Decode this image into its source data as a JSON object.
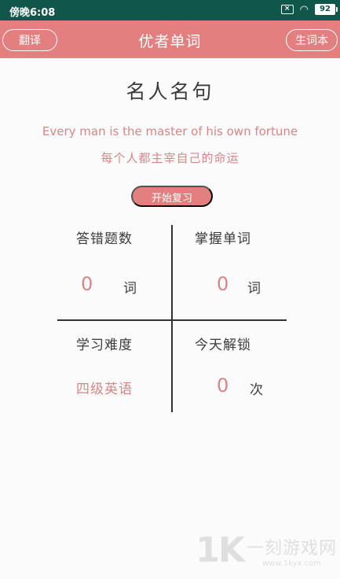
{
  "status_bar": {
    "time": "傍晚6:08",
    "sim_icon": "sim-x-icon",
    "wifi_icon": "wifi-icon",
    "battery": "92"
  },
  "app_bar": {
    "title": "优者单词",
    "left_button": "翻译",
    "right_button": "生词本",
    "color": "#e47f7f"
  },
  "quote": {
    "heading": "名人名句",
    "english": "Every man is the master of his own  fortune",
    "chinese": "每个人都主宰自己的命运"
  },
  "review_button": "开始复习",
  "stats": {
    "wrong": {
      "label": "答错题数",
      "value": "0",
      "unit": "词"
    },
    "mastered": {
      "label": "掌握单词",
      "value": "0",
      "unit": "词"
    },
    "difficulty": {
      "label": "学习难度",
      "value": "四级英语"
    },
    "unlock": {
      "label": "今天解锁",
      "value": "0",
      "unit": "次"
    }
  },
  "watermark": {
    "logo": "1K",
    "text": "一刻游戏网",
    "url": "www.1kyx.com"
  },
  "colors": {
    "accent": "#e47f7f",
    "status_bar": "#11564a",
    "value_text": "#d98585"
  }
}
